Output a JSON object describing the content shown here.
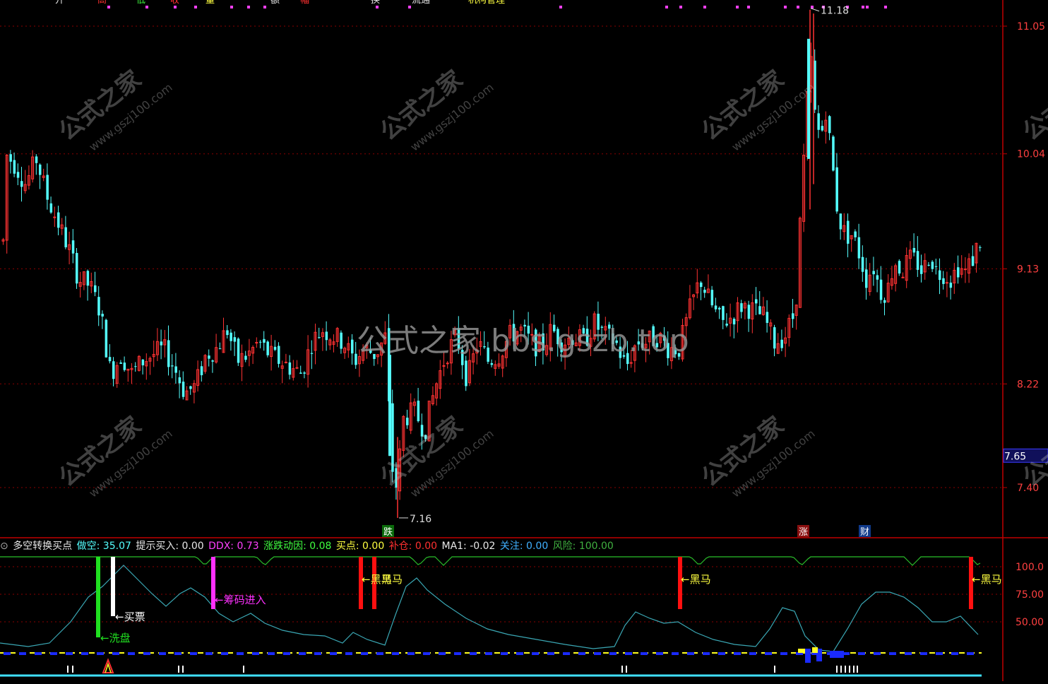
{
  "colors": {
    "up": "#ff3232",
    "down": "#54ffff",
    "grid": "#8b0000",
    "axis": "#c00000",
    "watermark": "#9a9a9a",
    "indicator_line": "#3aa7b4",
    "green_line": "#2bbf2b"
  },
  "top_strip": {
    "labels": [
      "开",
      "高",
      "低",
      "收",
      "量",
      "额",
      "幅",
      "换",
      "流通",
      "机构管理"
    ]
  },
  "price_axis": {
    "ticks": [
      "11.05",
      "10.04",
      "9.13",
      "8.22",
      "7.40"
    ],
    "current_price": "7.65"
  },
  "annotations": {
    "high_label": "11.18",
    "low_label": "7.16",
    "event_down": "跌",
    "event_up": "涨",
    "event_finance": "财"
  },
  "watermark": {
    "main": "公式之家 bbs.gszb.top",
    "small": "公式之家",
    "url": "www.gszj100.com"
  },
  "indicator": {
    "name": "多空转换买点",
    "fields": [
      {
        "label": "做空:",
        "value": "35.07",
        "color": "#54ffff"
      },
      {
        "label": "提示买入:",
        "value": "0.00",
        "color": "#e8e8e8"
      },
      {
        "label": "DDX:",
        "value": "0.73",
        "color": "#ff40ff"
      },
      {
        "label": "涨跌动因:",
        "value": "0.08",
        "color": "#40ff40"
      },
      {
        "label": "买点:",
        "value": "0.00",
        "color": "#ffff40"
      },
      {
        "label": "补仓:",
        "value": "0.00",
        "color": "#ff3030"
      },
      {
        "label": "MA1:",
        "value": "-0.02",
        "color": "#e8e8e8"
      },
      {
        "label": "关注:",
        "value": "0.00",
        "color": "#40b0ff"
      },
      {
        "label": "风险:",
        "value": "100.00",
        "color": "#40b040"
      }
    ],
    "axis_ticks": [
      "100.0",
      "75.00",
      "50.00"
    ],
    "signals": {
      "wash": "洗盘",
      "buy": "买票",
      "chips": "筹码进入",
      "darkhorse": "黑马",
      "darkhorse2": "黑马",
      "darkhorse3": "黑马"
    }
  },
  "chart_data": {
    "type": "candlestick",
    "ylim": [
      7.0,
      11.25
    ],
    "yticks": [
      11.05,
      10.04,
      9.13,
      8.22,
      7.4
    ],
    "high": 11.18,
    "low": 7.16,
    "last": 7.65,
    "indicator_ylim": [
      20,
      105
    ],
    "indicator_yticks": [
      100,
      75,
      50
    ]
  }
}
